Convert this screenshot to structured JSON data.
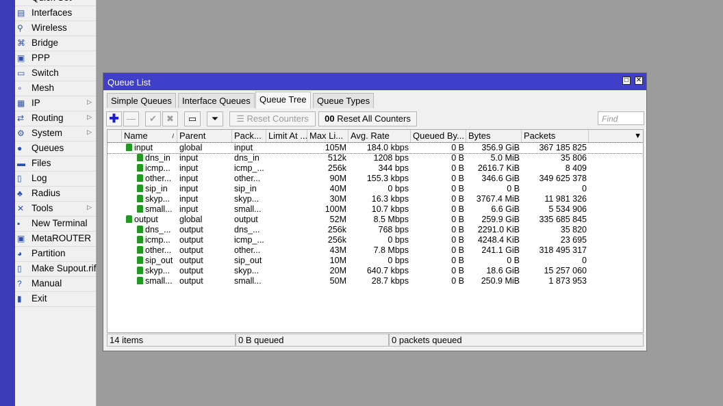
{
  "menu": [
    {
      "label": "Quick Set",
      "icon": "quick-set-icon",
      "submenu": false
    },
    {
      "label": "Interfaces",
      "icon": "interfaces-icon",
      "submenu": false
    },
    {
      "label": "Wireless",
      "icon": "wireless-icon",
      "submenu": false
    },
    {
      "label": "Bridge",
      "icon": "bridge-icon",
      "submenu": false
    },
    {
      "label": "PPP",
      "icon": "ppp-icon",
      "submenu": false
    },
    {
      "label": "Switch",
      "icon": "switch-icon",
      "submenu": false
    },
    {
      "label": "Mesh",
      "icon": "mesh-icon",
      "submenu": false
    },
    {
      "label": "IP",
      "icon": "ip-icon",
      "submenu": true
    },
    {
      "label": "Routing",
      "icon": "routing-icon",
      "submenu": true
    },
    {
      "label": "System",
      "icon": "system-icon",
      "submenu": true
    },
    {
      "label": "Queues",
      "icon": "queues-icon",
      "submenu": false
    },
    {
      "label": "Files",
      "icon": "files-icon",
      "submenu": false
    },
    {
      "label": "Log",
      "icon": "log-icon",
      "submenu": false
    },
    {
      "label": "Radius",
      "icon": "radius-icon",
      "submenu": false
    },
    {
      "label": "Tools",
      "icon": "tools-icon",
      "submenu": true
    },
    {
      "label": "New Terminal",
      "icon": "terminal-icon",
      "submenu": false
    },
    {
      "label": "MetaROUTER",
      "icon": "metarouter-icon",
      "submenu": false
    },
    {
      "label": "Partition",
      "icon": "partition-icon",
      "submenu": false
    },
    {
      "label": "Make Supout.rif",
      "icon": "supout-icon",
      "submenu": false
    },
    {
      "label": "Manual",
      "icon": "manual-icon",
      "submenu": false
    },
    {
      "label": "Exit",
      "icon": "exit-icon",
      "submenu": false
    }
  ],
  "window": {
    "title": "Queue List",
    "tabs": [
      "Simple Queues",
      "Interface Queues",
      "Queue Tree",
      "Queue Types"
    ],
    "active_tab": "Queue Tree",
    "toolbar": {
      "reset_counters": "Reset Counters",
      "reset_all_counters": "Reset All Counters",
      "find_placeholder": "Find",
      "oo": "00"
    },
    "columns": [
      "Name",
      "Parent",
      "Pack...",
      "Limit At ...",
      "Max Li...",
      "Avg. Rate",
      "Queued By...",
      "Bytes",
      "Packets"
    ],
    "rows": [
      {
        "level": 0,
        "name": "input",
        "parent": "global",
        "packet": "input",
        "limit_at": "",
        "max_limit": "105M",
        "avg_rate": "184.0 kbps",
        "queued": "0 B",
        "bytes": "356.9 GiB",
        "packets": "367 185 825"
      },
      {
        "level": 1,
        "name": "dns_in",
        "parent": "input",
        "packet": "dns_in",
        "limit_at": "",
        "max_limit": "512k",
        "avg_rate": "1208 bps",
        "queued": "0 B",
        "bytes": "5.0 MiB",
        "packets": "35 806"
      },
      {
        "level": 1,
        "name": "icmp...",
        "parent": "input",
        "packet": "icmp_...",
        "limit_at": "",
        "max_limit": "256k",
        "avg_rate": "344 bps",
        "queued": "0 B",
        "bytes": "2616.7 KiB",
        "packets": "8 409"
      },
      {
        "level": 1,
        "name": "other...",
        "parent": "input",
        "packet": "other...",
        "limit_at": "",
        "max_limit": "90M",
        "avg_rate": "155.3 kbps",
        "queued": "0 B",
        "bytes": "346.6 GiB",
        "packets": "349 625 378"
      },
      {
        "level": 1,
        "name": "sip_in",
        "parent": "input",
        "packet": "sip_in",
        "limit_at": "",
        "max_limit": "40M",
        "avg_rate": "0 bps",
        "queued": "0 B",
        "bytes": "0 B",
        "packets": "0"
      },
      {
        "level": 1,
        "name": "skyp...",
        "parent": "input",
        "packet": "skyp...",
        "limit_at": "",
        "max_limit": "30M",
        "avg_rate": "16.3 kbps",
        "queued": "0 B",
        "bytes": "3767.4 MiB",
        "packets": "11 981 326"
      },
      {
        "level": 1,
        "name": "small...",
        "parent": "input",
        "packet": "small...",
        "limit_at": "",
        "max_limit": "100M",
        "avg_rate": "10.7 kbps",
        "queued": "0 B",
        "bytes": "6.6 GiB",
        "packets": "5 534 906"
      },
      {
        "level": 0,
        "name": "output",
        "parent": "global",
        "packet": "output",
        "limit_at": "",
        "max_limit": "52M",
        "avg_rate": "8.5 Mbps",
        "queued": "0 B",
        "bytes": "259.9 GiB",
        "packets": "335 685 845"
      },
      {
        "level": 1,
        "name": "dns_...",
        "parent": "output",
        "packet": "dns_...",
        "limit_at": "",
        "max_limit": "256k",
        "avg_rate": "768 bps",
        "queued": "0 B",
        "bytes": "2291.0 KiB",
        "packets": "35 820"
      },
      {
        "level": 1,
        "name": "icmp...",
        "parent": "output",
        "packet": "icmp_...",
        "limit_at": "",
        "max_limit": "256k",
        "avg_rate": "0 bps",
        "queued": "0 B",
        "bytes": "4248.4 KiB",
        "packets": "23 695"
      },
      {
        "level": 1,
        "name": "other...",
        "parent": "output",
        "packet": "other...",
        "limit_at": "",
        "max_limit": "43M",
        "avg_rate": "7.8 Mbps",
        "queued": "0 B",
        "bytes": "241.1 GiB",
        "packets": "318 495 317"
      },
      {
        "level": 1,
        "name": "sip_out",
        "parent": "output",
        "packet": "sip_out",
        "limit_at": "",
        "max_limit": "10M",
        "avg_rate": "0 bps",
        "queued": "0 B",
        "bytes": "0 B",
        "packets": "0"
      },
      {
        "level": 1,
        "name": "skyp...",
        "parent": "output",
        "packet": "skyp...",
        "limit_at": "",
        "max_limit": "20M",
        "avg_rate": "640.7 kbps",
        "queued": "0 B",
        "bytes": "18.6 GiB",
        "packets": "15 257 060"
      },
      {
        "level": 1,
        "name": "small...",
        "parent": "output",
        "packet": "small...",
        "limit_at": "",
        "max_limit": "50M",
        "avg_rate": "28.7 kbps",
        "queued": "0 B",
        "bytes": "250.9 MiB",
        "packets": "1 873 953"
      }
    ],
    "status": {
      "items": "14 items",
      "queued_bytes": "0 B queued",
      "queued_packets": "0 packets queued"
    }
  },
  "colors": {
    "title_bar": "#3f3fc9",
    "left_bar": "#3c3cb8",
    "queue_icon": "#1f9a1f"
  }
}
